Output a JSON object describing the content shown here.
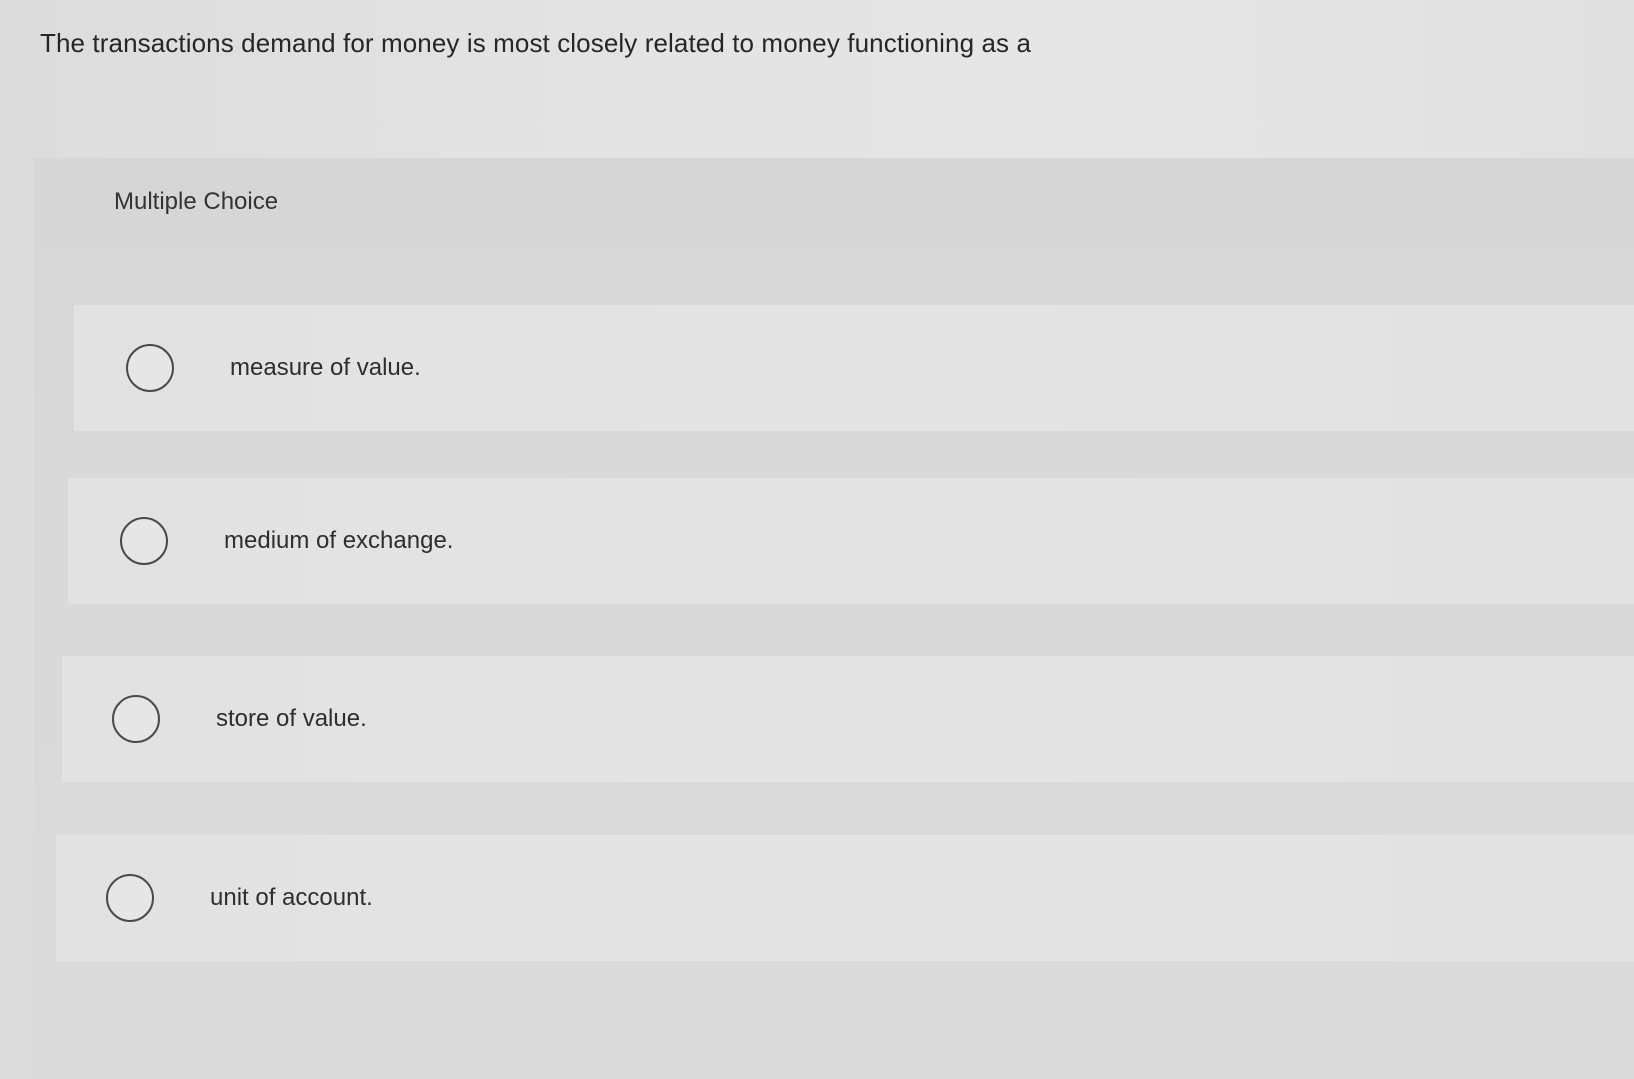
{
  "question": {
    "text": "The transactions demand for money is most closely related to money functioning as a"
  },
  "panel": {
    "type_label": "Multiple Choice"
  },
  "options": [
    {
      "label": "measure of value.",
      "selected": false
    },
    {
      "label": "medium of exchange.",
      "selected": false
    },
    {
      "label": "store of value.",
      "selected": false
    },
    {
      "label": "unit of account.",
      "selected": false
    }
  ]
}
